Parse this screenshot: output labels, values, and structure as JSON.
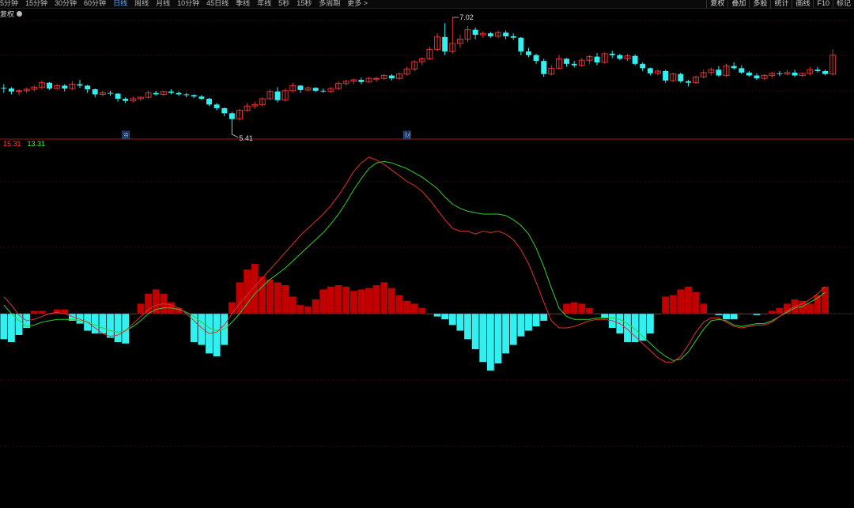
{
  "toolbar": {
    "periods": [
      "5分钟",
      "15分钟",
      "30分钟",
      "60分钟",
      "日线",
      "周线",
      "月线",
      "10分钟",
      "45日线",
      "季线",
      "年线",
      "5秒",
      "15秒",
      "多周期",
      "更多 >"
    ],
    "active_period": "日线",
    "tools": [
      "复权",
      "叠加",
      "多股",
      "统计",
      "画线",
      "F10",
      "标记"
    ],
    "adjust_label": "复权"
  },
  "indicator_values": {
    "line1": "15.31",
    "line2": "13.31"
  },
  "colors": {
    "up": "#e23333",
    "down": "#33f0f0",
    "diff_line": "#e03030",
    "dea_line": "#30d030",
    "grid": "#7a1010"
  },
  "chart_data": [
    {
      "type": "candlestick",
      "annotations": {
        "high_label": "7.02",
        "low_label": "5.41",
        "markers": [
          "资",
          "财"
        ]
      },
      "candles": [
        [
          6.05,
          6.1,
          5.98,
          6.04
        ],
        [
          6.04,
          6.06,
          5.96,
          6.0
        ],
        [
          6.0,
          6.03,
          5.95,
          6.01
        ],
        [
          6.01,
          6.05,
          5.98,
          6.03
        ],
        [
          6.03,
          6.08,
          6.0,
          6.06
        ],
        [
          6.06,
          6.15,
          6.03,
          6.12
        ],
        [
          6.12,
          6.13,
          6.02,
          6.04
        ],
        [
          6.04,
          6.1,
          6.02,
          6.08
        ],
        [
          6.08,
          6.1,
          6.0,
          6.04
        ],
        [
          6.04,
          6.14,
          6.02,
          6.1
        ],
        [
          6.1,
          6.16,
          6.05,
          6.08
        ],
        [
          6.08,
          6.09,
          5.98,
          6.03
        ],
        [
          6.03,
          6.04,
          5.92,
          5.96
        ],
        [
          5.96,
          6.01,
          5.93,
          5.98
        ],
        [
          5.98,
          6.01,
          5.94,
          5.97
        ],
        [
          5.97,
          5.98,
          5.86,
          5.9
        ],
        [
          5.9,
          5.92,
          5.84,
          5.87
        ],
        [
          5.87,
          5.93,
          5.85,
          5.9
        ],
        [
          5.9,
          5.93,
          5.87,
          5.92
        ],
        [
          5.92,
          6.01,
          5.9,
          5.98
        ],
        [
          5.98,
          6.01,
          5.94,
          5.96
        ],
        [
          5.96,
          6.01,
          5.94,
          6.0
        ],
        [
          6.0,
          6.03,
          5.96,
          5.98
        ],
        [
          5.98,
          6.0,
          5.94,
          5.96
        ],
        [
          5.96,
          5.98,
          5.92,
          5.95
        ],
        [
          5.95,
          5.96,
          5.91,
          5.93
        ],
        [
          5.93,
          5.95,
          5.88,
          5.9
        ],
        [
          5.9,
          5.91,
          5.8,
          5.82
        ],
        [
          5.82,
          5.84,
          5.74,
          5.77
        ],
        [
          5.77,
          5.78,
          5.66,
          5.7
        ],
        [
          5.7,
          5.72,
          5.41,
          5.62
        ],
        [
          5.62,
          5.76,
          5.6,
          5.74
        ],
        [
          5.74,
          5.84,
          5.72,
          5.8
        ],
        [
          5.8,
          5.86,
          5.76,
          5.82
        ],
        [
          5.82,
          5.92,
          5.79,
          5.9
        ],
        [
          5.9,
          6.03,
          5.88,
          6.0
        ],
        [
          6.0,
          6.06,
          5.85,
          5.88
        ],
        [
          5.88,
          6.04,
          5.86,
          6.01
        ],
        [
          6.01,
          6.12,
          5.98,
          6.08
        ],
        [
          6.08,
          6.09,
          5.98,
          6.02
        ],
        [
          6.02,
          6.07,
          6.0,
          6.05
        ],
        [
          6.05,
          6.06,
          5.99,
          6.01
        ],
        [
          6.01,
          6.04,
          5.98,
          6.0
        ],
        [
          6.0,
          6.06,
          5.98,
          6.04
        ],
        [
          6.04,
          6.14,
          6.02,
          6.11
        ],
        [
          6.11,
          6.16,
          6.08,
          6.14
        ],
        [
          6.14,
          6.18,
          6.1,
          6.16
        ],
        [
          6.16,
          6.19,
          6.1,
          6.13
        ],
        [
          6.13,
          6.2,
          6.12,
          6.18
        ],
        [
          6.18,
          6.2,
          6.13,
          6.18
        ],
        [
          6.18,
          6.24,
          6.16,
          6.22
        ],
        [
          6.22,
          6.24,
          6.15,
          6.18
        ],
        [
          6.18,
          6.26,
          6.16,
          6.24
        ],
        [
          6.24,
          6.34,
          6.22,
          6.31
        ],
        [
          6.31,
          6.43,
          6.28,
          6.41
        ],
        [
          6.41,
          6.47,
          6.36,
          6.45
        ],
        [
          6.45,
          6.62,
          6.43,
          6.58
        ],
        [
          6.58,
          6.8,
          6.55,
          6.75
        ],
        [
          6.75,
          6.94,
          6.5,
          6.55
        ],
        [
          6.55,
          7.02,
          6.52,
          6.66
        ],
        [
          6.66,
          6.78,
          6.6,
          6.72
        ],
        [
          6.72,
          6.9,
          6.68,
          6.85
        ],
        [
          6.85,
          6.88,
          6.72,
          6.78
        ],
        [
          6.78,
          6.83,
          6.74,
          6.8
        ],
        [
          6.8,
          6.82,
          6.74,
          6.76
        ],
        [
          6.76,
          6.84,
          6.73,
          6.81
        ],
        [
          6.81,
          6.84,
          6.72,
          6.76
        ],
        [
          6.76,
          6.8,
          6.71,
          6.74
        ],
        [
          6.74,
          6.75,
          6.5,
          6.55
        ],
        [
          6.55,
          6.6,
          6.47,
          6.5
        ],
        [
          6.5,
          6.52,
          6.38,
          6.42
        ],
        [
          6.42,
          6.45,
          6.2,
          6.24
        ],
        [
          6.24,
          6.36,
          6.22,
          6.32
        ],
        [
          6.32,
          6.5,
          6.3,
          6.45
        ],
        [
          6.45,
          6.46,
          6.34,
          6.38
        ],
        [
          6.38,
          6.42,
          6.33,
          6.36
        ],
        [
          6.36,
          6.46,
          6.34,
          6.43
        ],
        [
          6.43,
          6.5,
          6.38,
          6.48
        ],
        [
          6.48,
          6.53,
          6.36,
          6.4
        ],
        [
          6.4,
          6.54,
          6.38,
          6.52
        ],
        [
          6.52,
          6.56,
          6.46,
          6.5
        ],
        [
          6.5,
          6.52,
          6.43,
          6.45
        ],
        [
          6.45,
          6.52,
          6.42,
          6.49
        ],
        [
          6.49,
          6.51,
          6.36,
          6.38
        ],
        [
          6.38,
          6.4,
          6.28,
          6.32
        ],
        [
          6.32,
          6.33,
          6.22,
          6.25
        ],
        [
          6.25,
          6.3,
          6.22,
          6.28
        ],
        [
          6.28,
          6.3,
          6.12,
          6.15
        ],
        [
          6.15,
          6.26,
          6.13,
          6.24
        ],
        [
          6.24,
          6.26,
          6.12,
          6.14
        ],
        [
          6.14,
          6.16,
          6.07,
          6.12
        ],
        [
          6.12,
          6.22,
          6.1,
          6.2
        ],
        [
          6.2,
          6.3,
          6.18,
          6.26
        ],
        [
          6.26,
          6.33,
          6.22,
          6.3
        ],
        [
          6.3,
          6.35,
          6.2,
          6.22
        ],
        [
          6.22,
          6.38,
          6.2,
          6.35
        ],
        [
          6.35,
          6.4,
          6.3,
          6.32
        ],
        [
          6.32,
          6.36,
          6.24,
          6.26
        ],
        [
          6.26,
          6.28,
          6.2,
          6.22
        ],
        [
          6.22,
          6.25,
          6.16,
          6.18
        ],
        [
          6.18,
          6.24,
          6.16,
          6.22
        ],
        [
          6.22,
          6.27,
          6.18,
          6.25
        ],
        [
          6.25,
          6.28,
          6.21,
          6.24
        ],
        [
          6.24,
          6.3,
          6.22,
          6.26
        ],
        [
          6.26,
          6.3,
          6.2,
          6.22
        ],
        [
          6.22,
          6.26,
          6.2,
          6.25
        ],
        [
          6.25,
          6.34,
          6.22,
          6.3
        ],
        [
          6.3,
          6.34,
          6.26,
          6.28
        ],
        [
          6.28,
          6.3,
          6.22,
          6.24
        ],
        [
          6.24,
          6.58,
          6.22,
          6.5
        ]
      ]
    },
    {
      "type": "macd",
      "diff": [
        0.12,
        0.06,
        -0.01,
        -0.05,
        -0.04,
        -0.02,
        0.0,
        0.01,
        0.0,
        -0.02,
        -0.04,
        -0.06,
        -0.1,
        -0.14,
        -0.16,
        -0.15,
        -0.12,
        -0.07,
        -0.02,
        0.03,
        0.06,
        0.07,
        0.06,
        0.04,
        0.0,
        -0.05,
        -0.1,
        -0.14,
        -0.13,
        -0.08,
        0.0,
        0.07,
        0.13,
        0.19,
        0.25,
        0.31,
        0.37,
        0.43,
        0.49,
        0.55,
        0.6,
        0.65,
        0.7,
        0.76,
        0.83,
        0.91,
        1.0,
        1.06,
        1.1,
        1.08,
        1.05,
        1.01,
        0.97,
        0.93,
        0.9,
        0.86,
        0.8,
        0.73,
        0.66,
        0.6,
        0.58,
        0.58,
        0.56,
        0.58,
        0.57,
        0.58,
        0.56,
        0.52,
        0.45,
        0.35,
        0.22,
        0.08,
        -0.05,
        -0.1,
        -0.1,
        -0.09,
        -0.07,
        -0.05,
        -0.04,
        -0.04,
        -0.05,
        -0.07,
        -0.11,
        -0.16,
        -0.21,
        -0.26,
        -0.31,
        -0.34,
        -0.34,
        -0.3,
        -0.22,
        -0.13,
        -0.06,
        -0.03,
        -0.03,
        -0.06,
        -0.09,
        -0.1,
        -0.09,
        -0.08,
        -0.08,
        -0.06,
        -0.02,
        0.02,
        0.05,
        0.07,
        0.1,
        0.14,
        0.19
      ],
      "dea": [
        0.06,
        0.0,
        -0.05,
        -0.09,
        -0.08,
        -0.06,
        -0.05,
        -0.04,
        -0.04,
        -0.04,
        -0.05,
        -0.06,
        -0.08,
        -0.1,
        -0.12,
        -0.13,
        -0.12,
        -0.09,
        -0.05,
        0.0,
        0.03,
        0.04,
        0.04,
        0.03,
        0.01,
        -0.02,
        -0.06,
        -0.1,
        -0.12,
        -0.11,
        -0.06,
        0.0,
        0.07,
        0.14,
        0.19,
        0.24,
        0.28,
        0.32,
        0.37,
        0.42,
        0.47,
        0.52,
        0.57,
        0.63,
        0.7,
        0.78,
        0.87,
        0.95,
        1.02,
        1.06,
        1.07,
        1.06,
        1.04,
        1.02,
        0.99,
        0.96,
        0.92,
        0.88,
        0.82,
        0.77,
        0.74,
        0.72,
        0.71,
        0.7,
        0.7,
        0.7,
        0.69,
        0.66,
        0.62,
        0.56,
        0.46,
        0.33,
        0.18,
        0.04,
        -0.02,
        -0.04,
        -0.04,
        -0.04,
        -0.03,
        -0.03,
        -0.03,
        -0.04,
        -0.07,
        -0.11,
        -0.16,
        -0.21,
        -0.26,
        -0.3,
        -0.33,
        -0.32,
        -0.27,
        -0.19,
        -0.11,
        -0.05,
        -0.04,
        -0.05,
        -0.08,
        -0.09,
        -0.08,
        -0.07,
        -0.07,
        -0.05,
        -0.02,
        0.01,
        0.04,
        0.05,
        0.08,
        0.11,
        0.15
      ],
      "macd": [
        -0.18,
        -0.2,
        -0.15,
        -0.1,
        0.02,
        0.02,
        0.0,
        0.03,
        0.03,
        -0.05,
        -0.07,
        -0.12,
        -0.14,
        -0.14,
        -0.17,
        -0.2,
        -0.21,
        0.0,
        0.07,
        0.14,
        0.17,
        0.14,
        0.08,
        0.04,
        0.0,
        -0.2,
        -0.22,
        -0.28,
        -0.3,
        -0.22,
        0.08,
        0.22,
        0.31,
        0.35,
        0.26,
        0.24,
        0.22,
        0.2,
        0.12,
        0.06,
        0.05,
        0.1,
        0.17,
        0.19,
        0.2,
        0.19,
        0.16,
        0.17,
        0.18,
        0.2,
        0.22,
        0.18,
        0.13,
        0.09,
        0.07,
        0.04,
        0.0,
        -0.02,
        -0.04,
        -0.08,
        -0.12,
        -0.18,
        -0.25,
        -0.34,
        -0.4,
        -0.35,
        -0.28,
        -0.22,
        -0.16,
        -0.12,
        -0.09,
        -0.05,
        0.0,
        0.0,
        0.07,
        0.08,
        0.07,
        0.04,
        0.0,
        -0.03,
        -0.1,
        -0.14,
        -0.2,
        -0.2,
        -0.19,
        -0.14,
        0.0,
        0.12,
        0.13,
        0.17,
        0.19,
        0.15,
        0.07,
        0.0,
        -0.01,
        -0.04,
        -0.04,
        0.0,
        0.0,
        -0.01,
        0.0,
        0.02,
        0.04,
        0.07,
        0.1,
        0.09,
        0.07,
        0.13,
        0.19
      ]
    }
  ]
}
